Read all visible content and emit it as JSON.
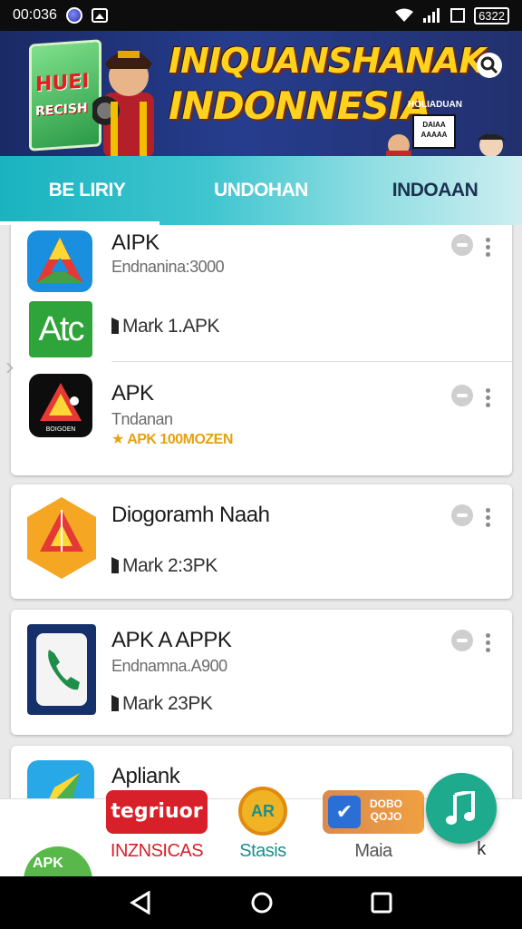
{
  "status_bar": {
    "time": "00:036",
    "battery": "6322"
  },
  "banner": {
    "sign_top": "HUEI",
    "sign_bottom": "RECISH",
    "title_line1": "INIQUANSHANAK",
    "title_line2": "INDONNESIA",
    "small_text": "HOLIADUAN",
    "box_text": "DAIAA AAAAA"
  },
  "tabs": [
    {
      "label": "BE LIRIY"
    },
    {
      "label": "UNDOHAN"
    },
    {
      "label": "INDOAAN"
    }
  ],
  "cards": [
    {
      "apps": [
        {
          "name": "AIPK",
          "subtitle": "Endnanina:3000"
        },
        {
          "icon_text": "Atc",
          "size": "Mark 1.APK"
        },
        {
          "name": "APK",
          "subtitle": "Tndanan",
          "badge": "APK 100MOZEN"
        }
      ]
    },
    {
      "apps": [
        {
          "name": "Diogoramh Naah",
          "size": "Mark 2:3PK"
        }
      ]
    },
    {
      "apps": [
        {
          "name": "APK A APPK",
          "subtitle": "Endnamna.A900",
          "size": "Mark 23PK"
        }
      ]
    },
    {
      "apps": [
        {
          "name": "Apliank"
        }
      ]
    }
  ],
  "app_icons": {
    "icon_a_text": "BOIGOEN",
    "apk_round": "APK"
  },
  "dock": [
    {
      "icon_text": "tegriuor",
      "label": "INZNSICAS",
      "color": "#d8202a"
    },
    {
      "icon_text": "AR",
      "label": "Stasis",
      "color": "#1a8f8f"
    },
    {
      "icon_text": "DOBO QOJO",
      "label": "Maia",
      "color": "#3a3a5a"
    },
    {
      "label": "k"
    }
  ],
  "fab": {
    "icon": "music-note-icon",
    "color": "#1eaa8d"
  },
  "colors": {
    "tab_start": "#1ab3c0",
    "tab_end": "#cdeef1",
    "badge": "#e8a10f"
  }
}
